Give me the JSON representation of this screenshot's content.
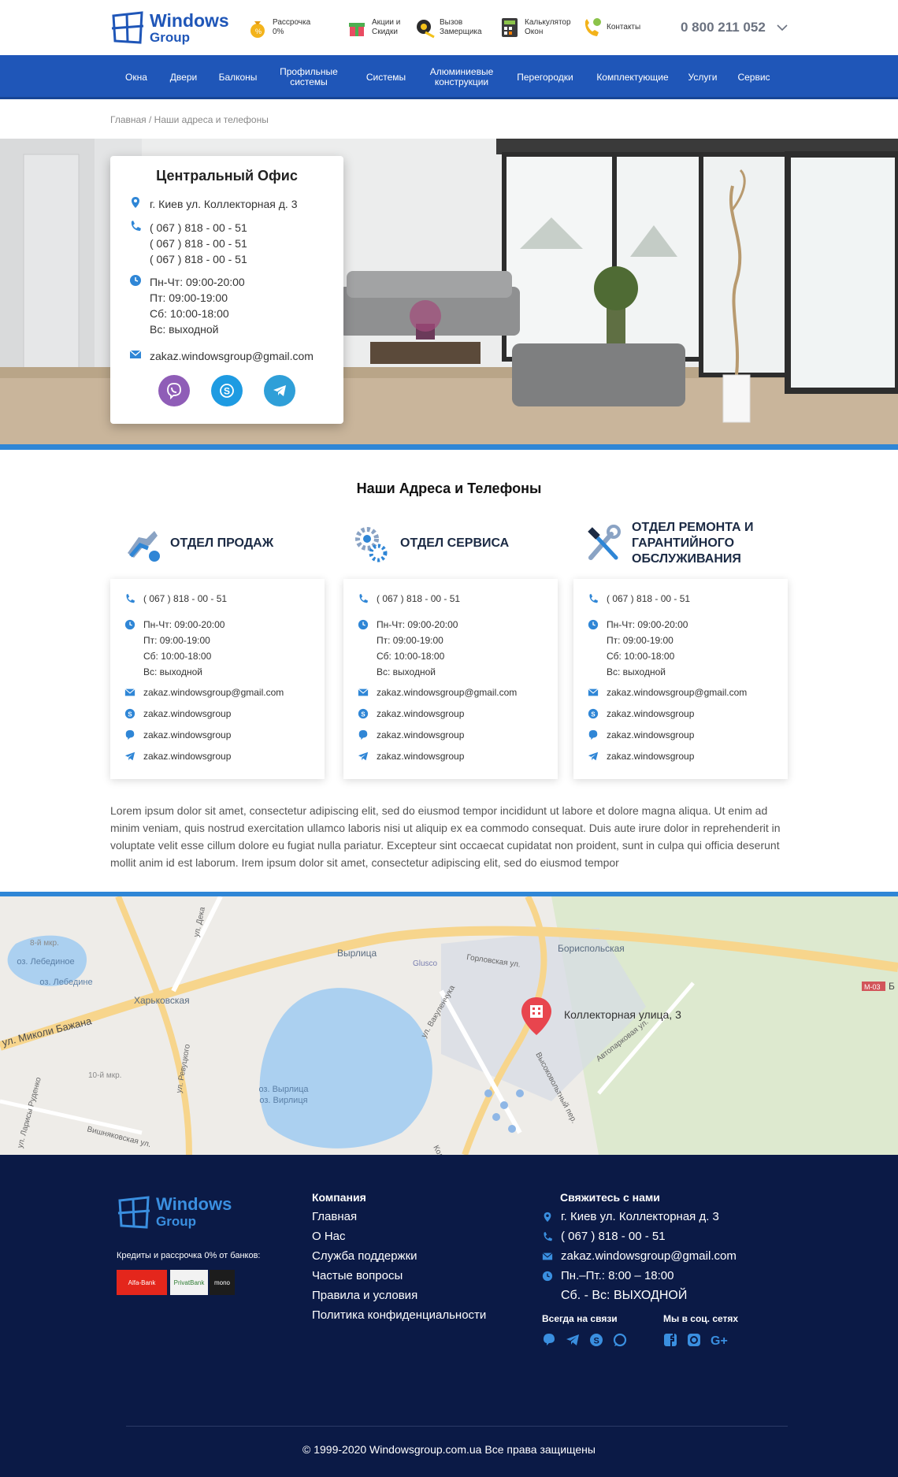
{
  "header": {
    "logo_line1": "Windows",
    "logo_line2": "Group",
    "items": [
      {
        "label": "Рассрочка 0%",
        "icon": "coin-bag-icon"
      },
      {
        "label": "Акции и Скидки",
        "icon": "gift-icon"
      },
      {
        "label": "Вызов Замерщика",
        "icon": "tape-measure-icon"
      },
      {
        "label": "Калькулятор Окон",
        "icon": "calculator-icon"
      },
      {
        "label": "Контакты",
        "icon": "phone-contact-icon"
      }
    ],
    "phone": "0 800 211 052"
  },
  "nav": {
    "items": [
      "Окна",
      "Двери",
      "Балконы",
      "Профильные системы",
      "Системы",
      "Алюминиевые конструкции",
      "Перегородки",
      "Комплектующие",
      "Услуги",
      "Сервис"
    ]
  },
  "breadcrumb": "Главная / Наши адреса и телефоны",
  "office": {
    "title": "Центральный  Офис",
    "address": "г. Киев  ул. Коллекторная д. 3",
    "phones": [
      "( 067 ) 818 - 00 - 51",
      "( 067 ) 818 - 00 - 51",
      "( 067 ) 818 - 00 - 51"
    ],
    "hours": [
      "Пн-Чт: 09:00-20:00",
      "Пт: 09:00-19:00",
      "Сб:  10:00-18:00",
      "Вс: выходной"
    ],
    "email": "zakaz.windowsgroup@gmail.com"
  },
  "section_title": "Наши Адреса и Телефоны",
  "departments": [
    {
      "title": "ОТДЕЛ ПРОДАЖ",
      "phone": "( 067 ) 818 - 00 - 51",
      "hours": [
        "Пн-Чт: 09:00-20:00",
        "Пт: 09:00-19:00",
        "Сб:  10:00-18:00",
        "Вс: выходной"
      ],
      "email": "zakaz.windowsgroup@gmail.com",
      "skype": "zakaz.windowsgroup",
      "viber": "zakaz.windowsgroup",
      "telegram": "zakaz.windowsgroup"
    },
    {
      "title": "ОТДЕЛ СЕРВИСА",
      "phone": "( 067 ) 818 - 00 - 51",
      "hours": [
        "Пн-Чт: 09:00-20:00",
        "Пт: 09:00-19:00",
        "Сб:  10:00-18:00",
        "Вс: выходной"
      ],
      "email": "zakaz.windowsgroup@gmail.com",
      "skype": "zakaz.windowsgroup",
      "viber": "zakaz.windowsgroup",
      "telegram": "zakaz.windowsgroup"
    },
    {
      "title": "ОТДЕЛ РЕМОНТА И ГАРАНТИЙНОГО ОБСЛУЖИВАНИЯ",
      "phone": "( 067 ) 818 - 00 - 51",
      "hours": [
        "Пн-Чт: 09:00-20:00",
        "Пт: 09:00-19:00",
        "Сб:  10:00-18:00",
        "Вс: выходной"
      ],
      "email": "zakaz.windowsgroup@gmail.com",
      "skype": "zakaz.windowsgroup",
      "viber": "zakaz.windowsgroup",
      "telegram": "zakaz.windowsgroup"
    }
  ],
  "lorem": "Lorem ipsum dolor sit amet, consectetur adipiscing elit, sed do eiusmod tempor incididunt ut labore et dolore magna aliqua. Ut enim ad minim veniam, quis nostrud exercitation ullamco laboris nisi ut aliquip ex ea commodo consequat. Duis aute irure dolor in reprehenderit in voluptate velit esse cillum dolore eu fugiat nulla pariatur. Excepteur sint occaecat cupidatat non proident, sunt in culpa qui officia deserunt mollit anim id est laborum. Irem ipsum dolor sit amet, consectetur adipiscing elit, sed do eiusmod tempor",
  "map": {
    "marker_label": "Коллекторная улица, 3",
    "labels": {
      "lake1": "оз. Лебединое",
      "lake1b": "оз. Лебедине",
      "lake2": "оз. Вырлица",
      "lake2b": "оз. Вирлиця",
      "metro1": "Харьковская",
      "metro2": "Вырлица",
      "metro3": "Бориспольская",
      "street1": "ул. Миколи Бажана",
      "street2": "Горловская ул.",
      "street3": "ул. Ревуцкого",
      "street4": "Вишняковская ул.",
      "street5": "ул. Вакуленчука",
      "street6": "Высоковольтный пер.",
      "street7": "Автопарковая ул.",
      "street8": "ул. Ларисы Руденко",
      "poi": "Glusco",
      "district": "10-й мкр.",
      "district2": "8-й мкр.",
      "road": "М-03",
      "misc1": "Колл",
      "misc2": "ул. Дека",
      "misc3": "Б"
    }
  },
  "footer": {
    "logo_line1": "Windows",
    "logo_line2": "Group",
    "credit_text": "Кредиты и рассрочка  0% от банков:",
    "banks": [
      "Alfa-Bank",
      "PrivatBank",
      "mono"
    ],
    "company_title": "Компания",
    "company_links": [
      "Главная",
      "О Нас",
      "Служба поддержки",
      "Частые вопросы",
      "Правила и условия",
      "Политика конфиденциальности"
    ],
    "contact_title": "Свяжитесь с нами",
    "address": "г. Киев  ул. Коллекторная д. 3",
    "phone": "( 067 ) 818 - 00 - 51",
    "email": "zakaz.windowsgroup@gmail.com",
    "hours1": "Пн.–Пт.: 8:00 – 18:00",
    "hours2": "Сб. - Вс: ВЫХОДНОЙ",
    "always_title": "Всегда на связи",
    "social_title": "Мы в соц. сетях",
    "copyright": "© 1999-2020 Windowsgroup.com.ua Все права защищены"
  },
  "colors": {
    "brand_blue": "#1f56b8",
    "accent_blue": "#2f86d6",
    "footer_bg": "#0b1a46"
  }
}
